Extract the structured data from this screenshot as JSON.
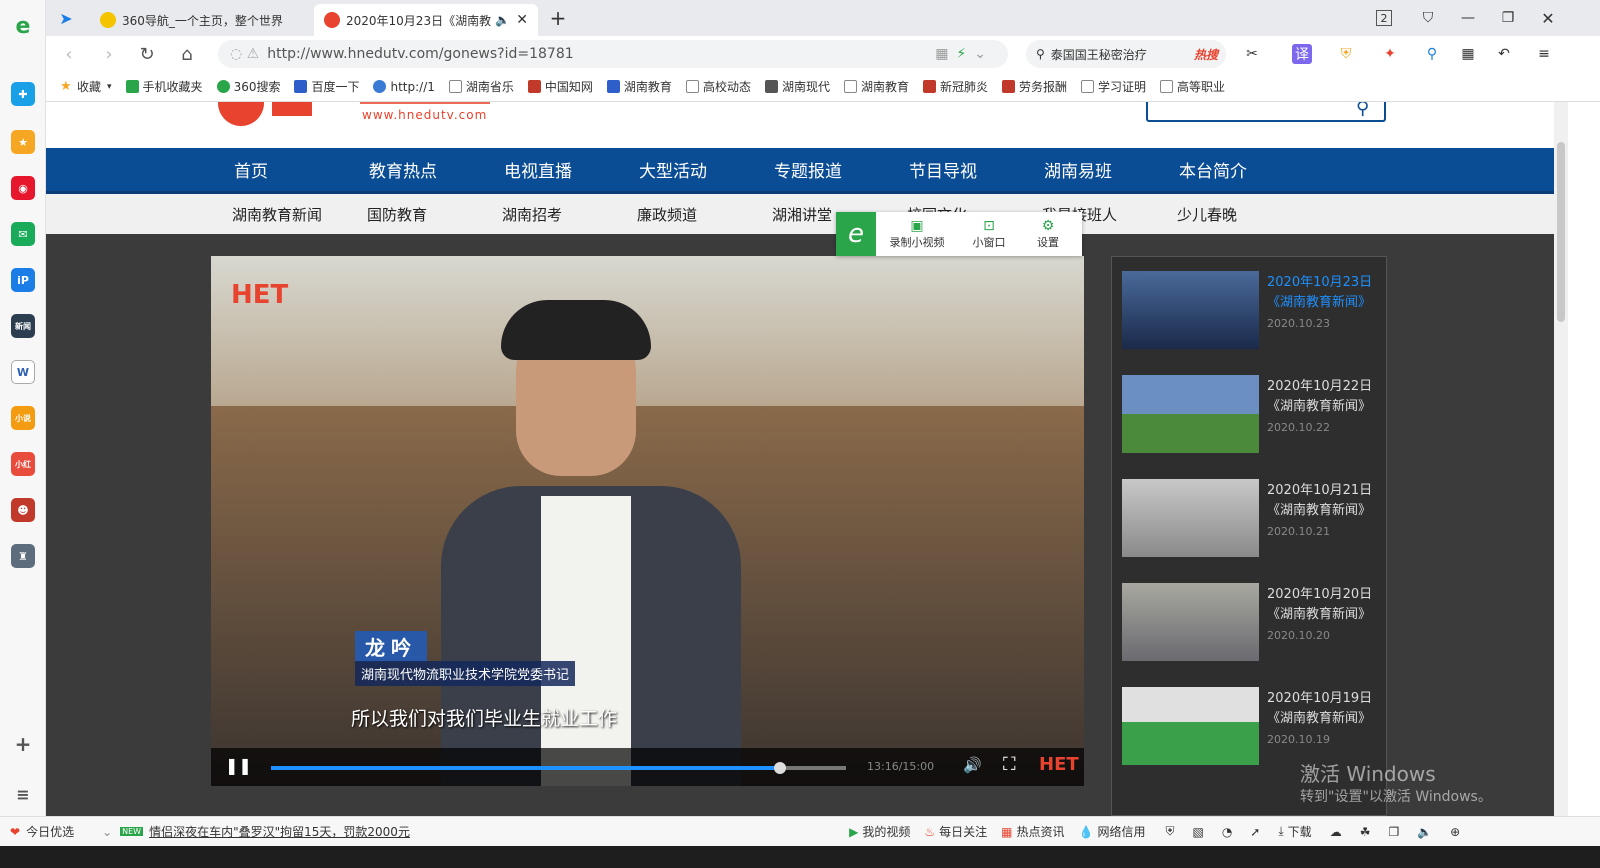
{
  "tabs": [
    {
      "title": "360导航_一个主页，整个世界"
    },
    {
      "title": "2020年10月23日《湖南教育"
    }
  ],
  "window": {
    "tab_count": "2"
  },
  "nav": {
    "url": "http://www.hnedutv.com/gonews?id=18781",
    "search_hot": "泰国国王秘密治疗",
    "hot_badge": "热搜"
  },
  "bookmarks": [
    "收藏",
    "手机收藏夹",
    "360搜索",
    "百度一下",
    "http://1",
    "湖南省乐",
    "中国知网",
    "湖南教育",
    "高校动态",
    "湖南现代",
    "湖南教育",
    "新冠肺炎",
    "劳务报酬",
    "学习证明",
    "高等职业"
  ],
  "site": {
    "logo_text": "www.hnedutv.com",
    "main_nav": [
      "首页",
      "教育热点",
      "电视直播",
      "大型活动",
      "专题报道",
      "节目导视",
      "湖南易班",
      "本台简介"
    ],
    "sub_nav": [
      "湖南教育新闻",
      "国防教育",
      "湖南招考",
      "廉政频道",
      "湖湘讲堂",
      "校园文化",
      "我是接班人",
      "少儿春晚"
    ]
  },
  "popup": {
    "record": "录制小视频",
    "mini": "小窗口",
    "settings": "设置"
  },
  "video": {
    "watermark": "HET",
    "name_tag": "龙吟",
    "title_tag": "湖南现代物流职业技术学院党委书记",
    "subtitle": "所以我们对我们毕业生就业工作",
    "time": "13:16/15:00",
    "progress": 0.885
  },
  "list": [
    {
      "date_title": "2020年10月23日",
      "show": "《湖南教育新闻》",
      "date": "2020.10.23",
      "active": true
    },
    {
      "date_title": "2020年10月22日",
      "show": "《湖南教育新闻》",
      "date": "2020.10.22"
    },
    {
      "date_title": "2020年10月21日",
      "show": "《湖南教育新闻》",
      "date": "2020.10.21"
    },
    {
      "date_title": "2020年10月20日",
      "show": "《湖南教育新闻》",
      "date": "2020.10.20"
    },
    {
      "date_title": "2020年10月19日",
      "show": "《湖南教育新闻》",
      "date": "2020.10.19"
    }
  ],
  "activation": {
    "line1": "激活 Windows",
    "line2": "转到\"设置\"以激活 Windows。"
  },
  "status": {
    "left": "今日优选",
    "news_badge": "NEW",
    "news": "情侣深夜在车内\"叠罗汉\"拘留15天，罚款2000元",
    "items": [
      "我的视频",
      "每日关注",
      "热点资讯",
      "网络信用"
    ],
    "download": "下载"
  },
  "colors": {
    "nav_blue": "#0b4d94",
    "accent": "#e8432e",
    "link_blue": "#1e90ff"
  }
}
